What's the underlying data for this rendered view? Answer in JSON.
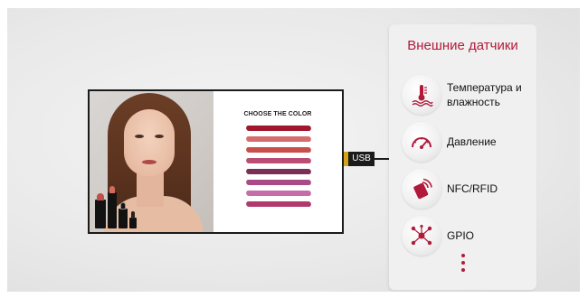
{
  "display": {
    "swatch_heading": "CHOOSE THE COLOR",
    "swatch_colors": [
      "#a1182e",
      "#d56d6d",
      "#c9504a",
      "#bb4d75",
      "#7a2f57",
      "#a84b86",
      "#c46da8",
      "#b2396d"
    ]
  },
  "usb": {
    "label": "USB"
  },
  "panel": {
    "title": "Внешние датчики",
    "sensors": [
      {
        "label": "Температура и влажность",
        "icon": "thermometer-water-icon"
      },
      {
        "label": "Давление",
        "icon": "pressure-gauge-icon"
      },
      {
        "label": "NFC/RFID",
        "icon": "nfc-card-icon"
      },
      {
        "label": "GPIO",
        "icon": "gpio-network-icon"
      }
    ],
    "more_icon": "vertical-ellipsis-icon"
  },
  "colors": {
    "accent": "#b21a3b"
  }
}
